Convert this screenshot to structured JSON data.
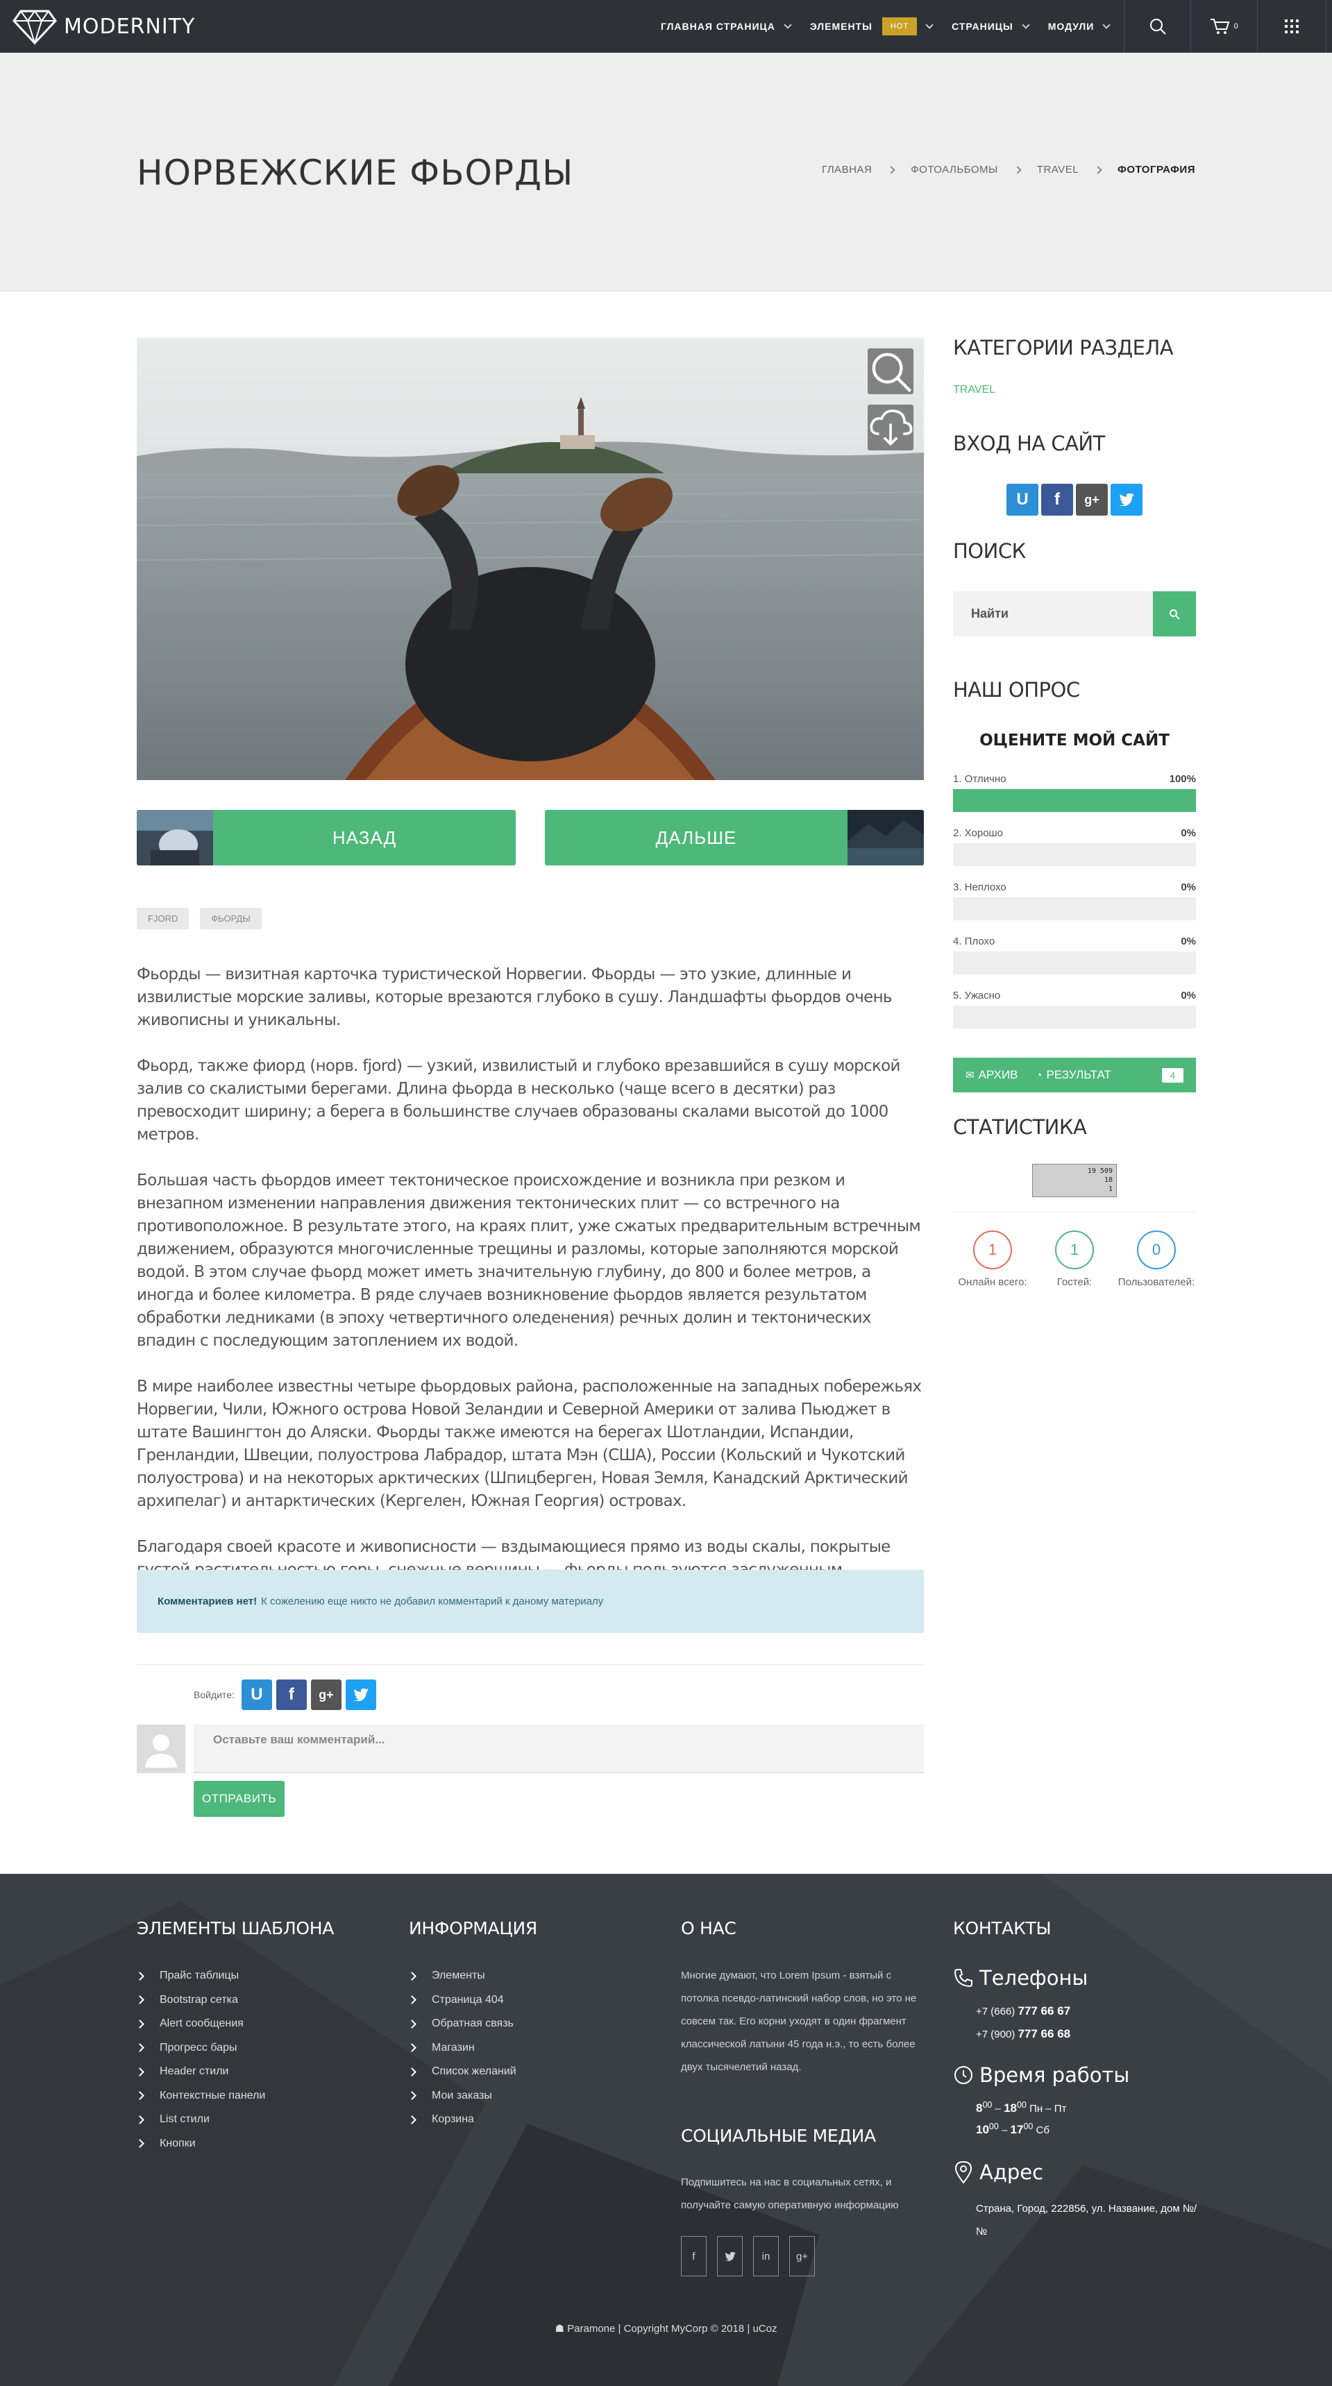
{
  "header": {
    "logo": "MODERNITY",
    "nav": [
      {
        "label": "ГЛАВНАЯ СТРАНИЦА",
        "dropdown": true
      },
      {
        "label": "ЭЛЕМЕНТЫ",
        "badge": "HOT",
        "dropdown": true
      },
      {
        "label": "СТРАНИЦЫ",
        "dropdown": true
      },
      {
        "label": "МОДУЛИ",
        "dropdown": true
      }
    ],
    "cart_count": "0",
    "icons": [
      "search-icon",
      "cart-icon",
      "grid-menu-icon"
    ]
  },
  "page": {
    "title": "НОРВЕЖСКИЕ ФЬОРДЫ",
    "breadcrumb": [
      "ГЛАВНАЯ",
      "ФОТОАЛЬБОМЫ",
      "TRAVEL",
      "ФОТОГРАФИЯ"
    ]
  },
  "photo": {
    "actions": [
      "zoom-icon",
      "download-cloud-icon"
    ]
  },
  "pager": {
    "prev": "НАЗАД",
    "next": "ДАЛЬШЕ"
  },
  "tags": [
    "FJORD",
    "ФЬОРДЫ"
  ],
  "article": [
    "Фьорды — визитная карточка туристической Норвегии. Фьорды — это узкие, длинные и извилистые морские заливы, которые врезаются глубоко в сушу. Ландшафты фьордов очень живописны и уникальны.",
    "Фьорд, также фиорд (норв. fjord) — узкий, извилистый и глубоко врезавшийся в сушу морской залив со скалистыми берегами. Длина фьорда в несколько (чаще всего в десятки) раз превосходит ширину; а берега в большинстве случаев образованы скалами высотой до 1000 метров.",
    "Большая часть фьордов имеет тектоническое происхождение и возникла при резком и внезапном изменении направления движения тектонических плит — со встречного на противоположное. В результате этого, на краях плит, уже сжатых предварительным встречным движением, образуются многочисленные трещины и разломы, которые заполняются морской водой. В этом случае фьорд может иметь значительную глубину, до 800 и более метров, а иногда и более километра. В ряде случаев возникновение фьордов является результатом обработки ледниками (в эпоху четвертичного оледенения) речных долин и тектонических впадин с последующим затоплением их водой.",
    "В мире наиболее известны четыре фьордовых района, расположенные на западных побережьях Норвегии, Чили, Южного острова Новой Зеландии и Северной Америки от залива Пьюджет в штате Вашингтон до Аляски. Фьорды также имеются на берегах Шотландии, Испандии, Гренландии, Швеции, полуострова Лабрадор, штата Мэн (США), России (Кольский и Чукотский полуострова) и на некоторых арктических (Шпицберген, Новая Земля, Канадский Арктический архипелаг) и антарктических (Кергелен, Южная Георгия) островах.",
    "Благодаря своей красоте и живописности — вздымающиеся прямо из воды скалы, покрытые густой растительностью горы, снежные вершины — фьорды пользуются заслуженным интересом у туристов всего мира."
  ],
  "comments": {
    "alert_bold": "Комментариев нет!",
    "alert_text": "К сожелению еще никто не добавил комментарий к даному материалу",
    "login_label": "Войдите:",
    "placeholder": "Оставьте ваш комментарий...",
    "submit": "ОТПРАВИТЬ"
  },
  "sidebar": {
    "categories_title": "КАТЕГОРИИ РАЗДЕЛА",
    "category": "TRAVEL",
    "login_title": "ВХОД НА САЙТ",
    "search_title": "ПОИСК",
    "search_placeholder": "Найти",
    "poll_title": "НАШ ОПРОС",
    "poll_question": "ОЦЕНИТЕ МОЙ САЙТ",
    "poll_options": [
      {
        "label": "1. Отлично",
        "percent_text": "100%",
        "value": 100
      },
      {
        "label": "2. Хорошо",
        "percent_text": "0%",
        "value": 0
      },
      {
        "label": "3. Неплохо",
        "percent_text": "0%",
        "value": 0
      },
      {
        "label": "4. Плохо",
        "percent_text": "0%",
        "value": 0
      },
      {
        "label": "5. Ужасно",
        "percent_text": "0%",
        "value": 0
      }
    ],
    "poll_archive": "АРХИВ",
    "poll_result": "РЕЗУЛЬТАТ",
    "poll_votes": "4",
    "stats_title": "СТАТИСТИКА",
    "counter_text": "19 509",
    "counter_small": "18",
    "counter_small2": "1",
    "stats": [
      {
        "value": "1",
        "label": "Онлайн всего:",
        "color": "#e06b5b"
      },
      {
        "value": "1",
        "label": "Гостей:",
        "color": "#4db87a"
      },
      {
        "value": "0",
        "label": "Пользователей:",
        "color": "#3a9ad9"
      }
    ]
  },
  "footer": {
    "col1_title": "ЭЛЕМЕНТЫ ШАБЛОНА",
    "col1_items": [
      "Прайс таблицы",
      "Bootstrap сетка",
      "Alert сообщения",
      "Прогресс бары",
      "Header стили",
      "Контекстные панели",
      "List стили",
      "Кнопки"
    ],
    "col2_title": "ИНФОРМАЦИЯ",
    "col2_items": [
      "Элементы",
      "Страница 404",
      "Обратная связь",
      "Магазин",
      "Список желаний",
      "Мои заказы",
      "Корзина"
    ],
    "about_title": "О НАС",
    "about_text": "Многие думают, что Lorem Ipsum - взятый с потолка псевдо-латинский набор слов, но это не совсем так. Его корни уходят в один фрагмент классической латыни 45 года н.э., то есть более двух тысячелетий назад.",
    "social_title": "СОЦИАЛЬНЫЕ МЕДИА",
    "social_text": "Подпишитесь на нас в социальных сетях, и получайте самую оперативную информацию",
    "social_icons": [
      "facebook-icon",
      "twitter-icon",
      "linkedin-icon",
      "google-plus-icon"
    ],
    "contacts_title": "КОНТАКТЫ",
    "phones_title": "Телефоны",
    "phones": [
      {
        "prefix": "+7 (666)",
        "number": "777 66 67"
      },
      {
        "prefix": "+7 (900)",
        "number": "777 66 68"
      }
    ],
    "hours_title": "Время работы",
    "hours": [
      {
        "from": "8",
        "from_sup": "00",
        "to": "18",
        "to_sup": "00",
        "days": "Пн – Пт"
      },
      {
        "from": "10",
        "from_sup": "00",
        "to": "17",
        "to_sup": "00",
        "days": "Сб"
      }
    ],
    "address_title": "Адрес",
    "address": "Страна, Город, 222856, ул. Название, дом №/№",
    "copyright": "Paramone | Copyright MyCorp © 2018 | uCoz"
  }
}
